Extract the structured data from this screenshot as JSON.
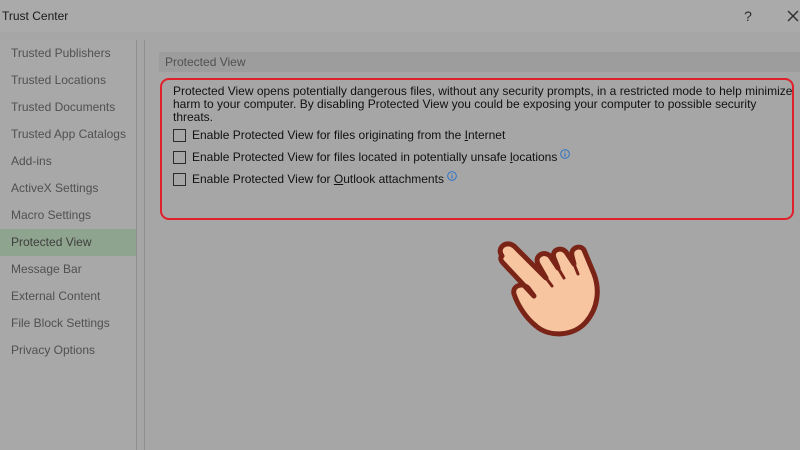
{
  "window": {
    "title": "Trust Center",
    "help_label": "?",
    "close_icon": "close-icon"
  },
  "sidebar": {
    "items": [
      {
        "label": "Trusted Publishers",
        "active": false
      },
      {
        "label": "Trusted Locations",
        "active": false
      },
      {
        "label": "Trusted Documents",
        "active": false
      },
      {
        "label": "Trusted App Catalogs",
        "active": false
      },
      {
        "label": "Add-ins",
        "active": false
      },
      {
        "label": "ActiveX Settings",
        "active": false
      },
      {
        "label": "Macro Settings",
        "active": false
      },
      {
        "label": "Protected View",
        "active": true
      },
      {
        "label": "Message Bar",
        "active": false
      },
      {
        "label": "External Content",
        "active": false
      },
      {
        "label": "File Block Settings",
        "active": false
      },
      {
        "label": "Privacy Options",
        "active": false
      }
    ]
  },
  "main": {
    "section_title": "Protected View",
    "description": "Protected View opens potentially dangerous files, without any security prompts, in a restricted mode to help minimize harm to your computer. By disabling Protected View you could be exposing your computer to possible security threats.",
    "options": [
      {
        "before": "Enable Protected View for files originating from the ",
        "accel": "I",
        "after": "nternet",
        "checked": false,
        "info": false
      },
      {
        "before": "Enable Protected View for files located in potentially unsafe ",
        "accel": "l",
        "after": "ocations",
        "checked": false,
        "info": true
      },
      {
        "before": "Enable Protected View for ",
        "accel": "O",
        "after": "utlook attachments",
        "checked": false,
        "info": true
      }
    ]
  },
  "colors": {
    "highlight": "#e0202a",
    "active_item": "#8fa48f",
    "hand_fill": "#f7c6a0",
    "hand_outline": "#7a2418"
  }
}
